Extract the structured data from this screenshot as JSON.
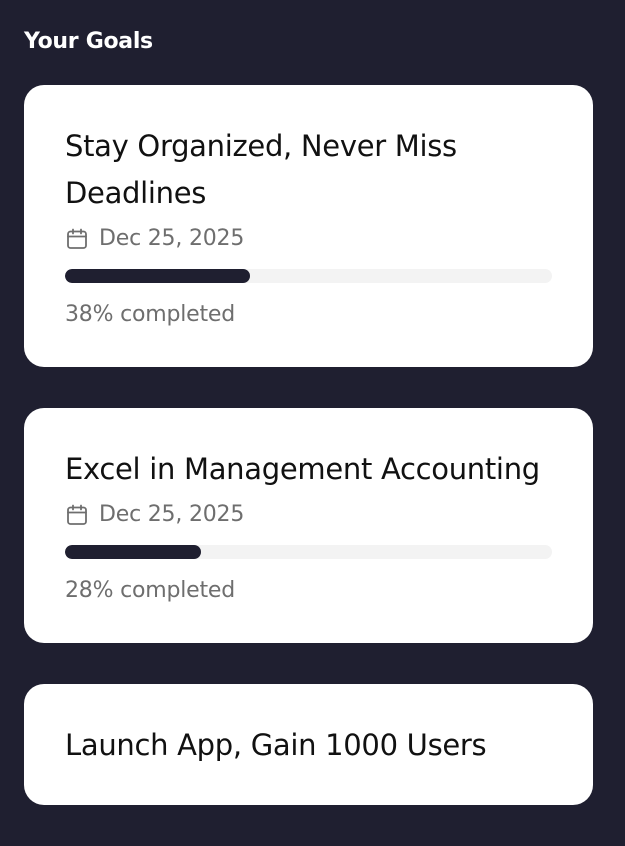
{
  "page": {
    "section_title": "Your Goals"
  },
  "goals": [
    {
      "title": "Stay Organized, Never Miss Deadlines",
      "date": "Dec 25, 2025",
      "date_icon": "calendar-icon",
      "progress_percent": 38,
      "progress_label": "38% completed"
    },
    {
      "title": "Excel in Management Accounting",
      "date": "Dec 25, 2025",
      "date_icon": "calendar-icon",
      "progress_percent": 28,
      "progress_label": "28% completed"
    },
    {
      "title": "Launch App, Gain 1000 Users",
      "date": "",
      "date_icon": "calendar-icon",
      "progress_percent": null,
      "progress_label": ""
    }
  ],
  "colors": {
    "background": "#1f1f30",
    "card": "#ffffff",
    "progress_fill": "#1f1f30",
    "progress_track": "#f3f3f3",
    "muted_text": "#6e6e6e"
  }
}
